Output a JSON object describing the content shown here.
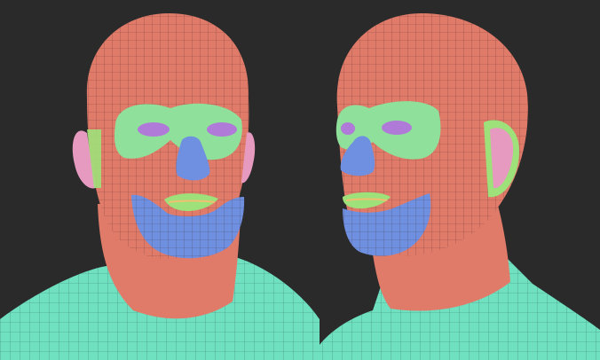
{
  "scene": {
    "description_hidden": "",
    "colors": {
      "background": "#2a2a2a",
      "skin": "#e07b6a",
      "eye_region": "#8fe09a",
      "eyelid": "#b07ad8",
      "nose_chin": "#6f8fe0",
      "lips": "#9ee07a",
      "lip_line": "#f0c070",
      "ear": "#e79ac0",
      "neck_shoulders": "#6fe0c0",
      "wire": "#3a1f1f"
    },
    "views": [
      {
        "name": "front-view"
      },
      {
        "name": "three-quarter-view"
      }
    ]
  }
}
